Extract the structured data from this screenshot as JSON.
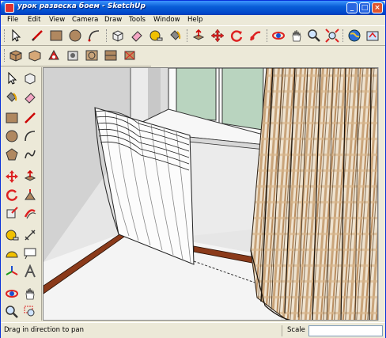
{
  "window": {
    "title": "урок развеска боем - SketchUp"
  },
  "titlebar_buttons": {
    "minimize": "_",
    "maximize": "□",
    "close": "×"
  },
  "menu": [
    "File",
    "Edit",
    "View",
    "Camera",
    "Draw",
    "Tools",
    "Window",
    "Help"
  ],
  "toolbar_main": [
    "select-icon",
    "eraser-icon",
    "pencil-icon",
    "rectangle-icon",
    "circle-icon",
    "arc-icon",
    "make-component-icon",
    "eraser-pink-icon",
    "tape-measure-icon",
    "paint-bucket-icon",
    "push-pull-icon",
    "move-icon",
    "rotate-icon",
    "follow-me-icon",
    "orbit-icon",
    "pan-icon",
    "zoom-icon",
    "zoom-extents-icon",
    "google-earth-icon",
    "get-models-icon"
  ],
  "toolbar_styles": [
    "wireframe-icon",
    "hidden-line-icon",
    "shaded-icon",
    "xray-icon",
    "textured-icon",
    "monochrome-icon",
    "back-edges-icon"
  ],
  "side_tools": [
    "select-icon",
    "make-component-icon",
    "paint-bucket-icon",
    "eraser-icon",
    "rectangle-icon",
    "line-icon",
    "circle-icon",
    "arc-icon",
    "polygon-icon",
    "freehand-icon",
    "move-icon",
    "push-pull-icon",
    "rotate-icon",
    "follow-me-icon",
    "scale-icon",
    "offset-icon",
    "tape-measure-icon",
    "dimension-icon",
    "protractor-icon",
    "text-icon",
    "axes-icon",
    "3d-text-icon",
    "orbit-icon",
    "pan-icon",
    "zoom-icon",
    "zoom-window-icon"
  ],
  "status": {
    "message": "Drag in direction to pan",
    "scale_label": "Scale",
    "scale_value": ""
  },
  "colors": {
    "title_gradient_top": "#3d95ff",
    "title_gradient_bottom": "#003cb0",
    "chrome": "#ece9d8",
    "wall": "#e6e6e6",
    "baseboard": "#8b3a1a",
    "glass": "#b9d4bf",
    "curtain_stripe": "#c9a47a"
  }
}
